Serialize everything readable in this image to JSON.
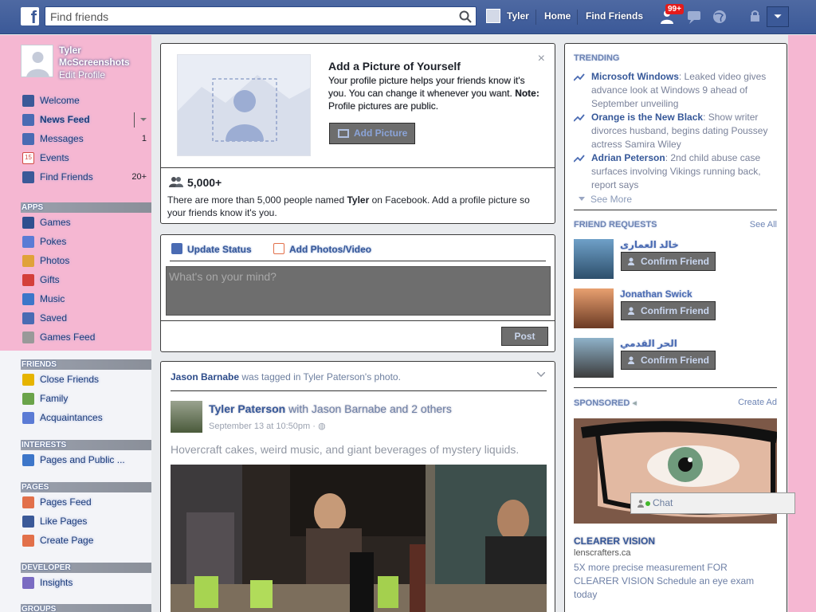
{
  "topbar": {
    "logo": "f",
    "search_placeholder": "Find friends",
    "user_name": "Tyler",
    "home": "Home",
    "find_friends": "Find Friends",
    "notifications_count": "99+"
  },
  "profile": {
    "name": "Tyler McScreenshots",
    "edit": "Edit Profile"
  },
  "nav": {
    "main": [
      {
        "label": "Welcome",
        "icon": "facebook-icon",
        "color": "#3b5998"
      },
      {
        "label": "News Feed",
        "icon": "news-feed-icon",
        "color": "#4a6bb3"
      },
      {
        "label": "Messages",
        "icon": "messages-icon",
        "count": "1",
        "color": "#4a6bb3"
      },
      {
        "label": "Events",
        "icon": "calendar-icon",
        "color": "#d24a43"
      },
      {
        "label": "Find Friends",
        "icon": "find-friends-icon",
        "count": "20+",
        "color": "#3b5998"
      }
    ],
    "apps_header": "APPS",
    "apps": [
      {
        "label": "Games",
        "color": "#2f4f8f"
      },
      {
        "label": "Pokes",
        "color": "#5b7bd5"
      },
      {
        "label": "Photos",
        "color": "#e0a23a"
      },
      {
        "label": "Gifts",
        "color": "#d43f3a"
      },
      {
        "label": "Music",
        "color": "#3d76c9"
      },
      {
        "label": "Saved",
        "color": "#4a6bb3"
      },
      {
        "label": "Games Feed",
        "color": "#999999"
      }
    ],
    "friends_header": "FRIENDS",
    "friends": [
      {
        "label": "Close Friends",
        "color": "#e6b400"
      },
      {
        "label": "Family",
        "color": "#6aa34a"
      },
      {
        "label": "Acquaintances",
        "color": "#5b7bd5"
      }
    ],
    "interests_header": "INTERESTS",
    "interests": [
      {
        "label": "Pages and Public ...",
        "color": "#3d76c9"
      }
    ],
    "pages_header": "PAGES",
    "pages": [
      {
        "label": "Pages Feed",
        "color": "#e2704a"
      },
      {
        "label": "Like Pages",
        "color": "#3b5998"
      },
      {
        "label": "Create Page",
        "color": "#e2704a"
      }
    ],
    "developer_header": "DEVELOPER",
    "developer": [
      {
        "label": "Insights",
        "color": "#7a6bc2"
      }
    ],
    "groups_header": "GROUPS"
  },
  "profile_picture_prompt": {
    "title": "Add a Picture of Yourself",
    "body": "Your profile picture helps your friends know it's you. You can change it whenever you want.",
    "note_label": "Note:",
    "note": " Profile pictures are public.",
    "button": "Add Picture",
    "people_count": "5,000+",
    "people_text_before": "There are more than 5,000 people named ",
    "people_text_name": "Tyler",
    "people_text_after": " on Facebook. Add a profile picture so your friends know it's you."
  },
  "composer": {
    "update_status": "Update Status",
    "add_photos": "Add Photos/Video",
    "placeholder": "What's on your mind?",
    "post": "Post"
  },
  "story": {
    "header_name": "Jason Barnabe",
    "header_rest": " was tagged in Tyler Paterson's photo.",
    "author": "Tyler Paterson",
    "with": " with Jason Barnabe and 2 others",
    "time": "September 13 at 10:50pm · ",
    "text": "Hovercraft cakes, weird music, and giant beverages of mystery liquids."
  },
  "trending": {
    "header": "TRENDING",
    "items": [
      {
        "topic": "Microsoft Windows",
        "desc": ": Leaked video gives advance look at Windows 9 ahead of September unveiling"
      },
      {
        "topic": "Orange is the New Black",
        "desc": ": Show writer divorces husband, begins dating Poussey actress Samira Wiley"
      },
      {
        "topic": "Adrian Peterson",
        "desc": ": 2nd child abuse case surfaces involving Vikings running back, report says"
      }
    ],
    "see_more": "See More"
  },
  "friend_requests": {
    "header": "FRIEND REQUESTS",
    "see_all": "See All",
    "button": "Confirm Friend",
    "items": [
      {
        "name": "خالد العمارى"
      },
      {
        "name": "Jonathan Swick"
      },
      {
        "name": "الحر القدمي"
      }
    ]
  },
  "sponsored": {
    "header": "SPONSORED",
    "create_ad": "Create Ad",
    "title": "CLEARER VISION",
    "domain": "lenscrafters.ca",
    "body": "5X more precise measurement FOR CLEARER VISION Schedule an eye exam today"
  },
  "chat": {
    "label": "Chat"
  },
  "colors": {
    "brand_blue": "#3b5998",
    "sidebar_pink": "#f5b7d2",
    "link": "#365899"
  }
}
